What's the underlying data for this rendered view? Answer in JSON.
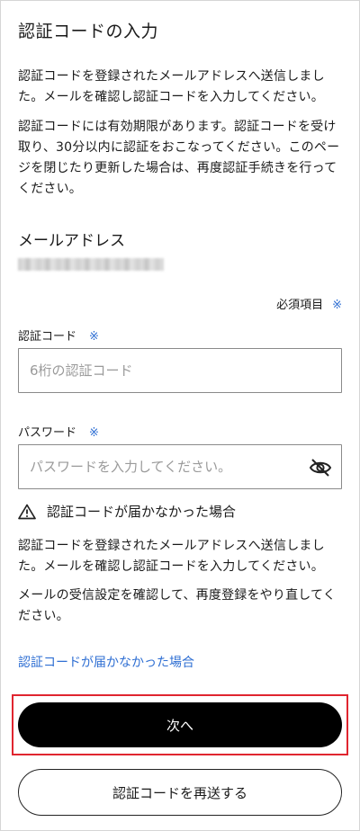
{
  "page": {
    "title": "認証コードの入力",
    "intro_text": "認証コードを登録されたメールアドレスへ送信しました。メールを確認し認証コードを入力してください。",
    "validity_text": "認証コードには有効期限があります。認証コードを受け取り、30分以内に認証をおこなってください。このページを閉じたり更新した場合は、再度認証手続きを行ってください。"
  },
  "email_section": {
    "label": "メールアドレス"
  },
  "form": {
    "required_note": "必須項目",
    "required_mark": "※",
    "code_field": {
      "label": "認証コード",
      "placeholder": "6桁の認証コード",
      "value": ""
    },
    "password_field": {
      "label": "パスワード",
      "placeholder": "パスワードを入力してください。",
      "value": "",
      "visibility_icon": "eye-off-icon"
    }
  },
  "help": {
    "heading": "認証コードが届かなかった場合",
    "heading_icon": "warning-icon",
    "text1": "認証コードを登録されたメールアドレスへ送信しました。メールを確認し認証コードを入力してください。",
    "text2": "メールの受信設定を確認して、再度登録をやり直してください。",
    "link_label": "認証コードが届かなかった場合"
  },
  "actions": {
    "next_label": "次へ",
    "resend_label": "認証コードを再送する"
  },
  "colors": {
    "accent_link": "#2f6fd3",
    "primary_button": "#000000",
    "highlight_border": "#e0252f"
  }
}
